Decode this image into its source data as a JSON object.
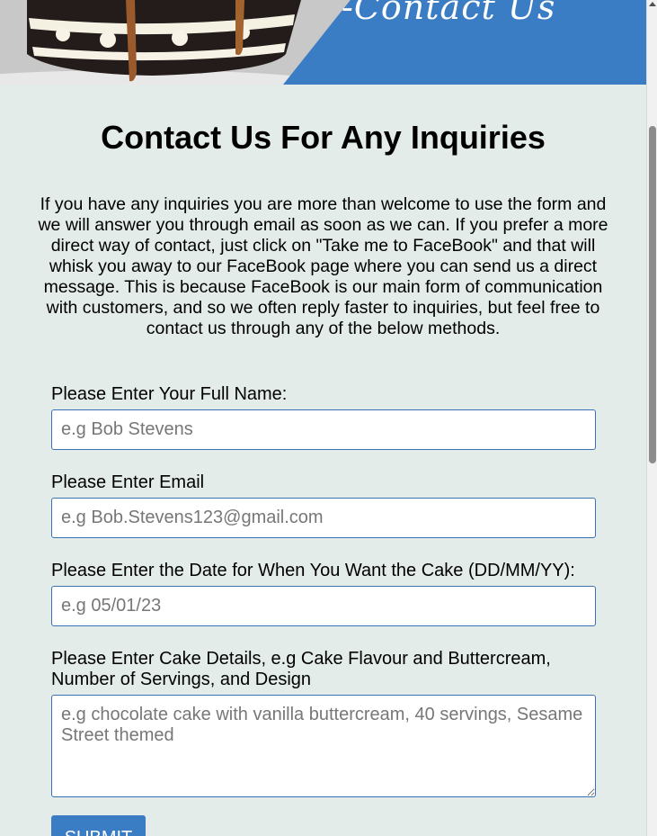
{
  "banner": {
    "title": "-Contact Us",
    "image_alt": "layered chocolate cake with buttercream and caramel drip"
  },
  "heading": "Contact Us For Any Inquiries",
  "intro": "If you have any inquiries you are more than welcome to use the form and we will answer you through email as soon as we can. If you prefer a more direct way of contact, just click on \"Take me to FaceBook\" and that will whisk you away to our FaceBook page where you can send us a direct message. This is because FaceBook is our main form of communication with customers, and so we often reply faster to inquiries, but feel free to contact us through any of the below methods.",
  "form": {
    "name_label": "Please Enter Your Full Name:",
    "name_placeholder": "e.g Bob Stevens",
    "email_label": "Please Enter Email",
    "email_placeholder": "e.g Bob.Stevens123@gmail.com",
    "date_label": "Please Enter the Date for When You Want the Cake (DD/MM/YY):",
    "date_placeholder": "e.g 05/01/23",
    "details_label": "Please Enter Cake Details, e.g Cake Flavour and Buttercream, Number of Servings, and Design",
    "details_placeholder": "e.g chocolate cake with vanilla buttercream, 40 servings, Sesame Street themed",
    "submit_label": "SUBMIT"
  },
  "colors": {
    "accent": "#3b7dc4",
    "background": "#e3ece8",
    "input_border": "#3a72b5"
  }
}
